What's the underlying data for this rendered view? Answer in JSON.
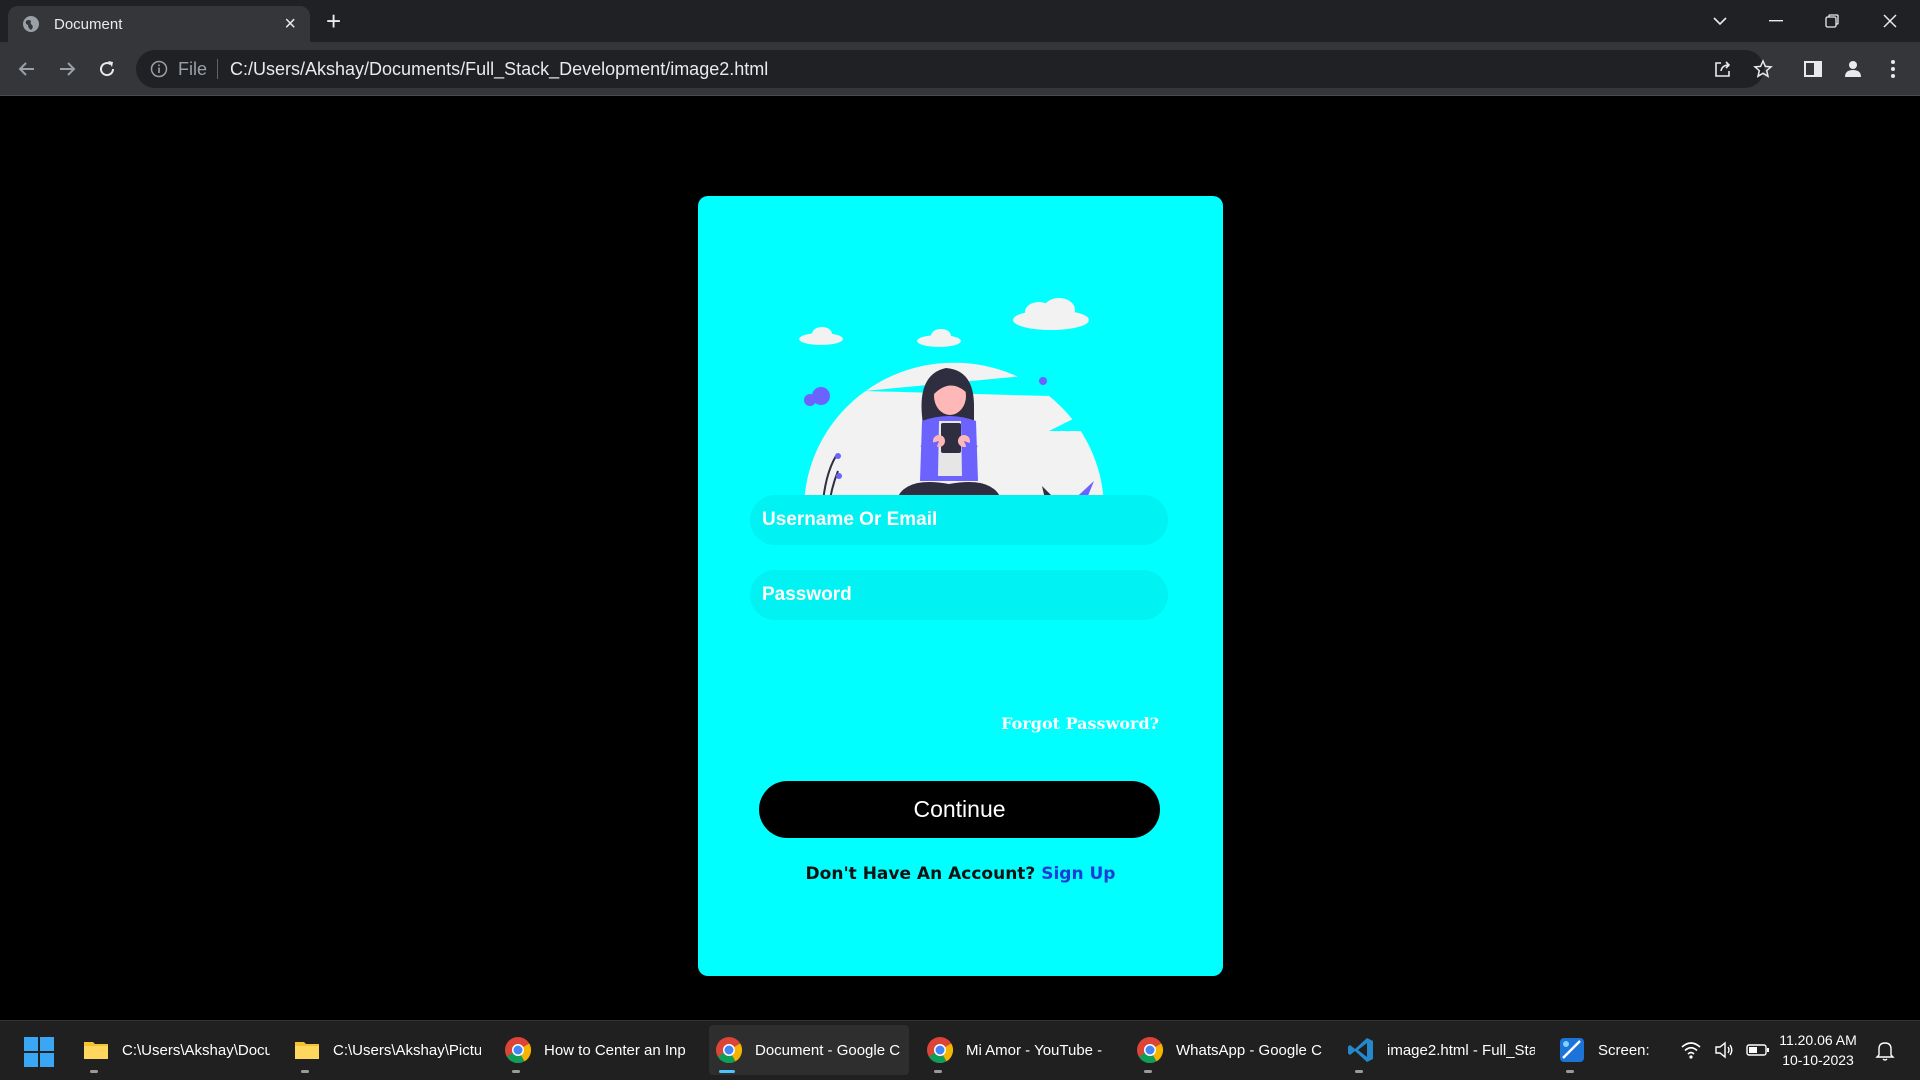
{
  "browser": {
    "tab_title": "Document",
    "scheme_label": "File",
    "url": "C:/Users/Akshay/Documents/Full_Stack_Development/image2.html"
  },
  "login": {
    "username_placeholder": "Username Or Email",
    "password_placeholder": "Password",
    "forgot_label": "Forgot Password?",
    "continue_label": "Continue",
    "no_account_text": "Don't Have An Account?",
    "signup_label": "Sign Up"
  },
  "colors": {
    "card_bg": "#00ffff",
    "field_bg": "#00f2f2",
    "button_bg": "#000000",
    "link": "#1a3dd6",
    "illustration_accent": "#6c63ff"
  },
  "taskbar": {
    "items": [
      {
        "label": "C:\\Users\\Akshay\\Docu",
        "icon": "folder-icon"
      },
      {
        "label": "C:\\Users\\Akshay\\Pictu",
        "icon": "folder-icon"
      },
      {
        "label": "How to Center an Inp",
        "icon": "chrome-icon"
      },
      {
        "label": "Document - Google C",
        "icon": "chrome-icon"
      },
      {
        "label": "Mi Amor - YouTube -",
        "icon": "chrome-icon"
      },
      {
        "label": "WhatsApp - Google C",
        "icon": "chrome-icon"
      },
      {
        "label": "image2.html - Full_Sta",
        "icon": "vscode-icon"
      },
      {
        "label": "Screen:",
        "icon": "snipping-tool-icon"
      }
    ],
    "time": "11.20.06 AM",
    "date": "10-10-2023"
  }
}
